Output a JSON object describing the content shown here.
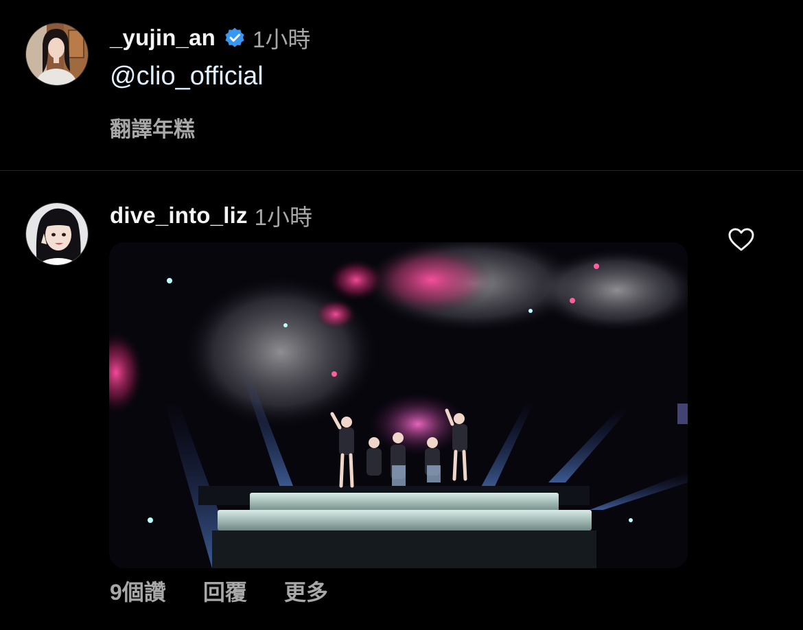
{
  "comments": [
    {
      "username": "_yujin_an",
      "verified": true,
      "time": "1小時",
      "text": "@clio_official",
      "translate_label": "翻譯年糕",
      "avatar_icon": "user-avatar-photo"
    },
    {
      "username": "dive_into_liz",
      "verified": false,
      "time": "1小時",
      "media_type": "gif",
      "avatar_icon": "user-avatar-photo",
      "actions": {
        "likes": "9個讚",
        "reply": "回覆",
        "more": "更多"
      }
    }
  ],
  "colors": {
    "background": "#000000",
    "username": "#f5f5f5",
    "muted": "#a8a8a8",
    "mention": "#e0f1ff",
    "verified_badge": "#3897f0",
    "divider": "#262626"
  },
  "icons": {
    "verified": "verified-badge-icon",
    "like": "heart-outline-icon"
  }
}
